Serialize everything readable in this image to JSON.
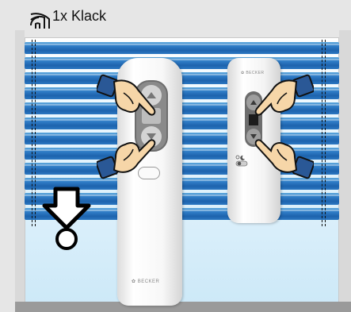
{
  "caption": {
    "text": "1x Klack",
    "icon": "sound-waves-icon"
  },
  "remote_large": {
    "brand": "BECKER"
  },
  "remote_small": {
    "brand": "BECKER"
  },
  "instruction": {
    "press_buttons": [
      "up",
      "down"
    ],
    "indicator": "down-arrow-icon"
  },
  "colors": {
    "slat": "#2f7cc6",
    "frame": "#d9d9d9",
    "sill": "#9a9a9a",
    "hand_cuff": "#2a5896",
    "hand_skin": "#f6d6a8"
  }
}
